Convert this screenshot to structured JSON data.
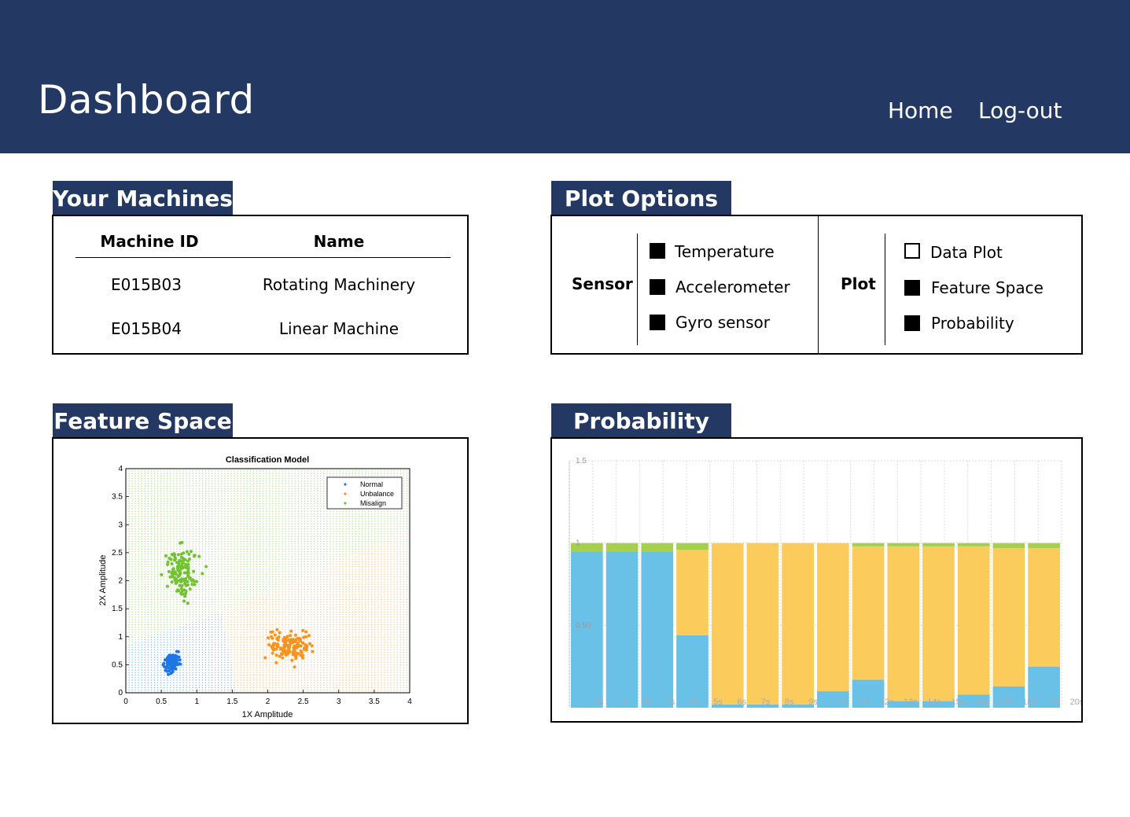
{
  "header": {
    "title": "Dashboard",
    "nav": [
      "Home",
      "Log-out"
    ]
  },
  "machines": {
    "tab": "Your Machines",
    "columns": [
      "Machine ID",
      "Name"
    ],
    "rows": [
      {
        "id": "E015B03",
        "name": "Rotating Machinery"
      },
      {
        "id": "E015B04",
        "name": "Linear Machine"
      }
    ]
  },
  "plot_options": {
    "tab": "Plot Options",
    "sensor_label": "Sensor",
    "sensors": [
      {
        "label": "Temperature",
        "checked": true
      },
      {
        "label": "Accelerometer",
        "checked": true
      },
      {
        "label": "Gyro sensor",
        "checked": true
      }
    ],
    "plot_label": "Plot",
    "plots": [
      {
        "label": "Data Plot",
        "checked": false
      },
      {
        "label": "Feature Space",
        "checked": true
      },
      {
        "label": "Probability",
        "checked": true
      }
    ]
  },
  "feature_space": {
    "tab": "Feature Space"
  },
  "probability": {
    "tab": "Probability"
  },
  "colors": {
    "navy": "#233963",
    "normal": "#1f77e4",
    "unbalance": "#f7931e",
    "misalign": "#72c232",
    "prob_blue": "#69c1e8",
    "prob_yellow": "#fbcb5b",
    "prob_green": "#a6cf4c"
  },
  "chart_data": [
    {
      "type": "scatter",
      "title": "Classification Model",
      "xlabel": "1X Amplitude",
      "ylabel": "2X Amplitude",
      "xlim": [
        0,
        4
      ],
      "ylim": [
        0,
        4
      ],
      "xticks": [
        "0",
        "0.5",
        "1",
        "1.5",
        "2",
        "2.5",
        "3",
        "3.5",
        "4"
      ],
      "yticks": [
        "0",
        "0.5",
        "1",
        "1.5",
        "2",
        "2.5",
        "3",
        "3.5",
        "4"
      ],
      "legend": [
        "Normal",
        "Unbalance",
        "Misalign"
      ],
      "legend_position": "top-right",
      "series": [
        {
          "name": "Normal",
          "center": [
            0.65,
            0.55
          ],
          "spread": [
            0.08,
            0.12
          ],
          "count": 110
        },
        {
          "name": "Unbalance",
          "center": [
            2.3,
            0.85
          ],
          "spread": [
            0.22,
            0.22
          ],
          "count": 130
        },
        {
          "name": "Misalign",
          "center": [
            0.8,
            2.15
          ],
          "spread": [
            0.18,
            0.32
          ],
          "count": 130
        }
      ]
    },
    {
      "type": "bar",
      "stacked": true,
      "yticks": [
        "1.5",
        "1",
        "0.50"
      ],
      "ylim": [
        0,
        1.5
      ],
      "grid": true,
      "categories": [
        "0s",
        "1s",
        "2s",
        "3s",
        "4s",
        "5s",
        "6s",
        "7s",
        "8s",
        "9s",
        "10s",
        "11s",
        "12s",
        "13s",
        "14s",
        "15s",
        "16s",
        "17s",
        "18s",
        "19s",
        "20s"
      ],
      "blue": [
        0.95,
        0.95,
        0.95,
        0.44,
        0.02,
        0.02,
        0.02,
        0.1,
        0.17,
        0.04,
        0.04,
        0.08,
        0.13,
        0.25
      ],
      "yellow": [
        0.0,
        0.0,
        0.0,
        0.52,
        0.98,
        0.98,
        0.98,
        0.9,
        0.81,
        0.94,
        0.94,
        0.9,
        0.84,
        0.72
      ],
      "green": [
        0.05,
        0.05,
        0.05,
        0.04,
        0.0,
        0.0,
        0.0,
        0.0,
        0.02,
        0.02,
        0.02,
        0.02,
        0.03,
        0.03
      ]
    }
  ]
}
